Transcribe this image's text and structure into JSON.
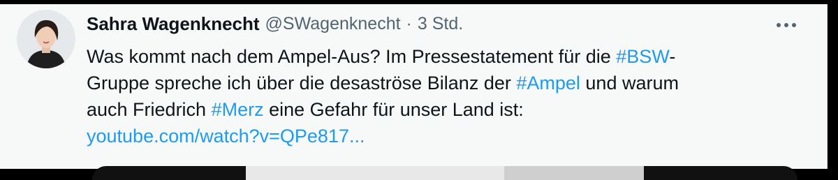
{
  "tweet": {
    "author_name": "Sahra Wagenknecht",
    "handle": "@SWagenknecht",
    "separator": "·",
    "time": "3 Std.",
    "more_icon": "more-horizontal-icon",
    "text": {
      "l1_a": "Was kommt nach dem Ampel-Aus? Im Pressestatement für die ",
      "l1_tag": "#BSW",
      "l1_b": "-",
      "l2_a": "Gruppe spreche ich über die desaströse Bilanz der ",
      "l2_tag": "#Ampel",
      "l2_b": " und warum",
      "l3_a": "auch Friedrich ",
      "l3_tag": "#Merz",
      "l3_b": " eine Gefahr für unser Land ist:",
      "link": "youtube.com/watch?v=QPe817..."
    },
    "colors": {
      "text": "#0f1419",
      "secondary": "#536471",
      "link": "#1d9bf0",
      "background": "#f7f9f9"
    }
  }
}
